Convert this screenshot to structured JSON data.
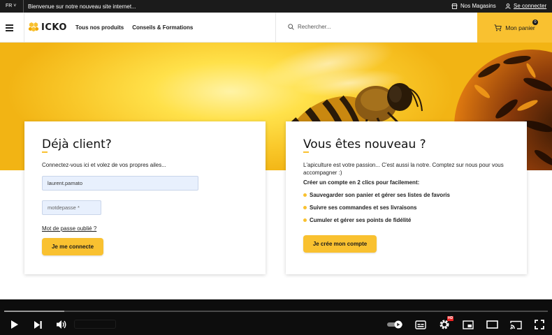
{
  "colors": {
    "accent": "#f9c130",
    "dark": "#1b1b1b",
    "input_bg": "#e8f0fd"
  },
  "topbar": {
    "language": "FR",
    "announcement": "Bienvenue sur notre nouveau site internet...",
    "stores_label": "Nos Magasins",
    "login_label": "Se connecter"
  },
  "header": {
    "logo_text": "ICKO",
    "nav": [
      "Tous nos produits",
      "Conseils & Formations"
    ],
    "search_placeholder": "Rechercher...",
    "cart_label": "Mon panier",
    "cart_count": "0"
  },
  "login_card": {
    "title": "Déjà client?",
    "intro": "Connectez-vous ici et volez de vos propres ailes...",
    "username_value": "laurent.pamato",
    "password_value": "motdepasse *",
    "forgot_link": "Mot de passe oublié ?",
    "submit_button": "Je me connecte"
  },
  "register_card": {
    "title": "Vous êtes nouveau ?",
    "intro": "L'apiculture est votre passion... C'est aussi la notre. Comptez sur nous pour vous accompagner :)",
    "create_title": "Créer un compte en 2 clics pour facilement:",
    "benefits": [
      "Sauvegarder son panier et gérer ses listes de favoris",
      "Suivre ses commandes et ses livraisons",
      "Cumuler et gérer ses points de fidélité"
    ],
    "create_button": "Je crée mon compte"
  },
  "player": {
    "progress_fraction": 0.11,
    "hd_badge": "HD",
    "icons": [
      "play-icon",
      "next-icon",
      "volume-icon",
      "autoplay-toggle-icon",
      "subtitles-icon",
      "settings-icon",
      "miniplayer-icon",
      "theater-icon",
      "cast-icon",
      "fullscreen-icon"
    ]
  }
}
